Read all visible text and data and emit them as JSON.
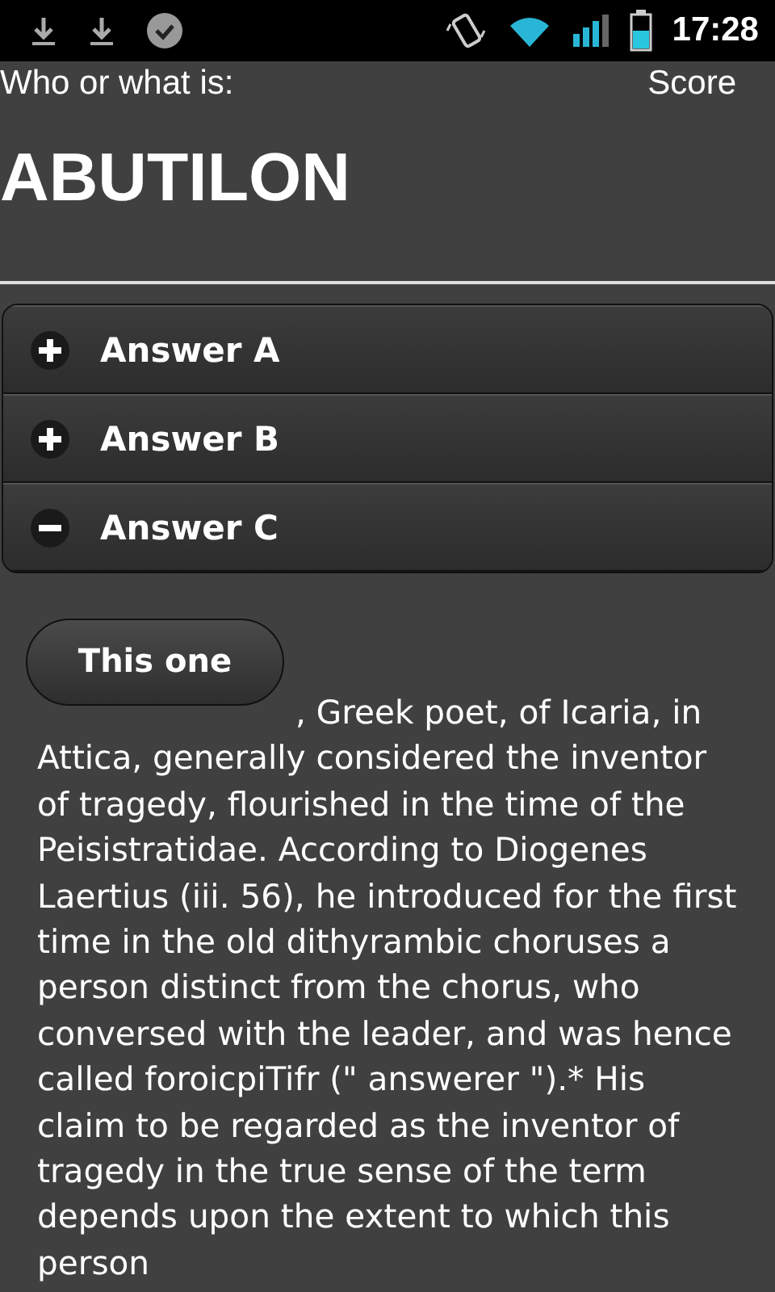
{
  "status_bar": {
    "time": "17:28"
  },
  "header": {
    "prompt": "Who or what is:",
    "score_label": "Score",
    "term": "ABUTILON"
  },
  "answers": [
    {
      "label": "Answer A",
      "expanded": false
    },
    {
      "label": "Answer B",
      "expanded": false
    },
    {
      "label": "Answer C",
      "expanded": true
    }
  ],
  "detail": {
    "button": "This one",
    "text": ", Greek poet, of Icaria, in Attica, generally considered the inventor of tragedy, flourished in the time of the Peisistratidae. According to Diogenes Laertius (iii. 56), he introduced for the first time in the old dithyrambic choruses a person distinct from the chorus, who conversed with the leader, and was hence called foroicpiTifr (\" answerer \").* His claim to be regarded as the inventor of tragedy in the true sense of the term depends upon the extent to which this person"
  }
}
